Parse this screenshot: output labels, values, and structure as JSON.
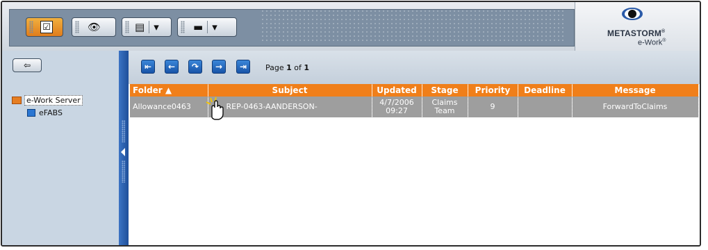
{
  "toolbar": {
    "buttons": [
      {
        "name": "checklist",
        "icon": "checkbox-icon"
      },
      {
        "name": "view",
        "icon": "eye-icon"
      },
      {
        "name": "folder",
        "icon": "folder-icon",
        "has_dropdown": true
      },
      {
        "name": "briefcase",
        "icon": "briefcase-icon",
        "has_dropdown": true
      }
    ],
    "check_glyph": "☑",
    "eye_glyph": "👁",
    "folder_glyph": "▤",
    "case_glyph": "▬",
    "dropdown_glyph": "▾"
  },
  "logo": {
    "line1": "METASTORM",
    "reg1": "®",
    "line2": "e-Work",
    "reg2": "®"
  },
  "left_panel": {
    "back_glyph": "⇦",
    "tree": [
      {
        "label": "e-Work Server",
        "selected": true
      },
      {
        "label": "eFABS",
        "selected": false
      }
    ]
  },
  "pager": {
    "first": "⇤",
    "prev": "←",
    "refresh": "↷",
    "next": "→",
    "last": "⇥",
    "prefix": "Page",
    "current": "1",
    "of": "of",
    "total": "1"
  },
  "table": {
    "headers": [
      "Folder ▲",
      "Subject",
      "Updated",
      "Stage",
      "Priority",
      "Deadline",
      "Message"
    ],
    "rows": [
      {
        "folder": "Allowance0463",
        "subject": "REP-0463-AANDERSON-",
        "updated_date": "4/7/2006",
        "updated_time": "09:27",
        "stage_1": "Claims",
        "stage_2": "Team",
        "priority": "9",
        "deadline": "",
        "message": "ForwardToClaims"
      }
    ]
  },
  "colors": {
    "accent": "#f07f1a",
    "nav_blue": "#1e4f9a",
    "row_gray": "#9e9e9e"
  }
}
